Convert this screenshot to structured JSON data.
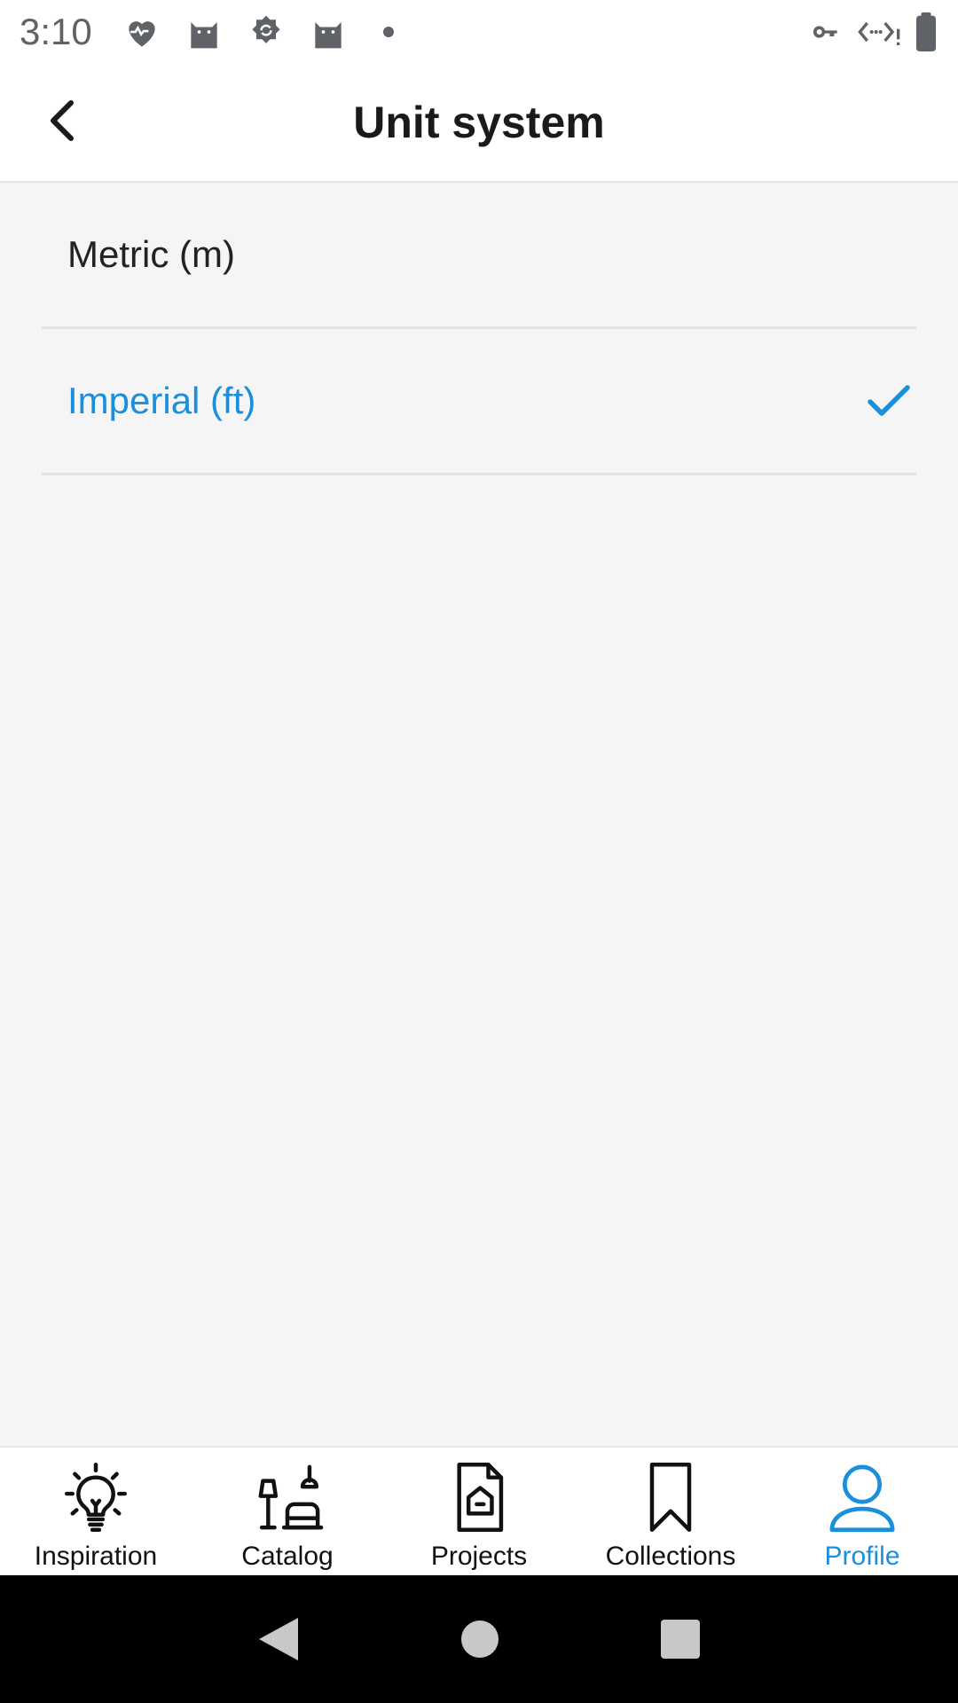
{
  "status_bar": {
    "time": "3:10",
    "left_icons": [
      "heart-pulse-icon",
      "cat-icon",
      "sync-badge-icon",
      "cat-icon",
      "notification-dot-icon"
    ],
    "right_icons": [
      "vpn-key-icon",
      "data-saver-icon",
      "battery-icon"
    ]
  },
  "app_bar": {
    "title": "Unit system",
    "back_icon": "chevron-left-icon"
  },
  "options": [
    {
      "label": "Metric (m)",
      "selected": false
    },
    {
      "label": "Imperial (ft)",
      "selected": true
    }
  ],
  "bottom_nav": {
    "items": [
      {
        "label": "Inspiration",
        "icon": "lightbulb-icon",
        "active": false
      },
      {
        "label": "Catalog",
        "icon": "furniture-icon",
        "active": false
      },
      {
        "label": "Projects",
        "icon": "project-file-icon",
        "active": false
      },
      {
        "label": "Collections",
        "icon": "bookmark-icon",
        "active": false
      },
      {
        "label": "Profile",
        "icon": "person-icon",
        "active": true
      }
    ]
  },
  "system_nav": [
    "back-triangle-icon",
    "home-circle-icon",
    "recents-square-icon"
  ],
  "colors": {
    "accent": "#1a8fdc",
    "background": "#f5f5f5",
    "text": "#222222"
  }
}
